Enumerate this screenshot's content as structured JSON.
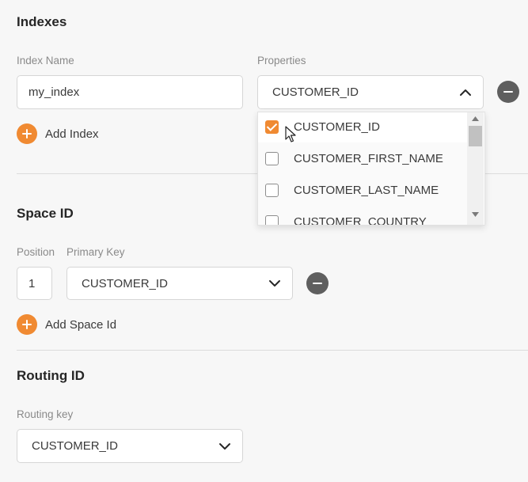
{
  "indexes": {
    "title": "Indexes",
    "index_name_label": "Index Name",
    "index_name_value": "my_index",
    "properties_label": "Properties",
    "properties_selected": "CUSTOMER_ID",
    "add_label": "Add Index",
    "dropdown_options": [
      {
        "label": "CUSTOMER_ID",
        "checked": true
      },
      {
        "label": "CUSTOMER_FIRST_NAME",
        "checked": false
      },
      {
        "label": "CUSTOMER_LAST_NAME",
        "checked": false
      },
      {
        "label": "CUSTOMER_COUNTRY",
        "checked": false
      }
    ]
  },
  "space_id": {
    "title": "Space ID",
    "position_label": "Position",
    "position_value": "1",
    "primary_key_label": "Primary Key",
    "primary_key_value": "CUSTOMER_ID",
    "add_label": "Add Space Id"
  },
  "routing_id": {
    "title": "Routing ID",
    "routing_key_label": "Routing key",
    "routing_key_value": "CUSTOMER_ID"
  },
  "colors": {
    "accent": "#f08a32",
    "remove": "#5f5f5f",
    "background": "#f7f7f7"
  },
  "icons": {
    "add": "plus-circle-icon",
    "remove": "minus-circle-icon",
    "expand": "chevron-down-icon",
    "collapse": "chevron-up-icon",
    "cursor": "mouse-pointer-icon"
  }
}
